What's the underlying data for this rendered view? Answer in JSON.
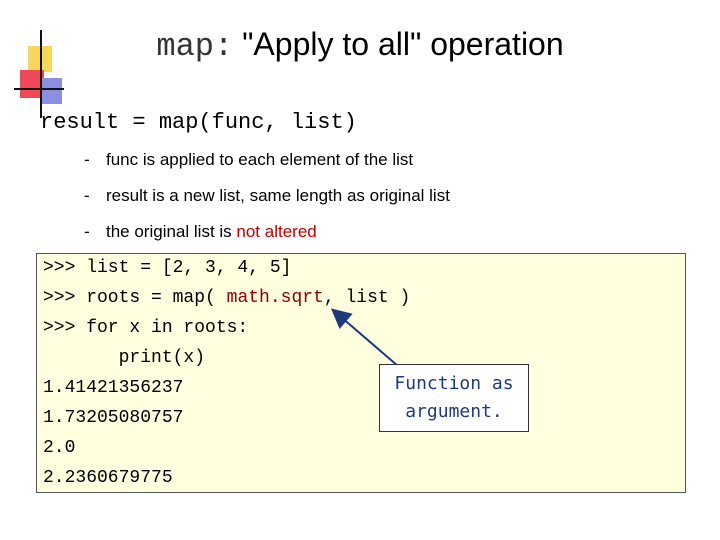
{
  "title": {
    "code": "map:",
    "text": "\"Apply to all\" operation"
  },
  "syntax": "result = map(func, list)",
  "bullets": [
    {
      "dash": "-",
      "text": "func is applied to each element of the list"
    },
    {
      "dash": "-",
      "text": "result is a new list, same length as original list"
    },
    {
      "dash": "-",
      "text": "the original list is ",
      "highlight": "not altered"
    }
  ],
  "code": {
    "line1": ">>> list = [2, 3, 4, 5]",
    "line2_prefix": ">>> roots = map( ",
    "line2_func": "math.sqrt",
    "line2_suffix": ", list )",
    "line3": ">>> for x in roots:",
    "line4": "       print(x)",
    "outputs": [
      "1.41421356237",
      "1.73205080757",
      "2.0",
      "2.2360679775"
    ]
  },
  "callout": {
    "line1": "Function as",
    "line2": "argument."
  },
  "colors": {
    "accent_red": "#c00000",
    "code_bg": "#ffffe0",
    "callout_text": "#1f3a7a"
  }
}
